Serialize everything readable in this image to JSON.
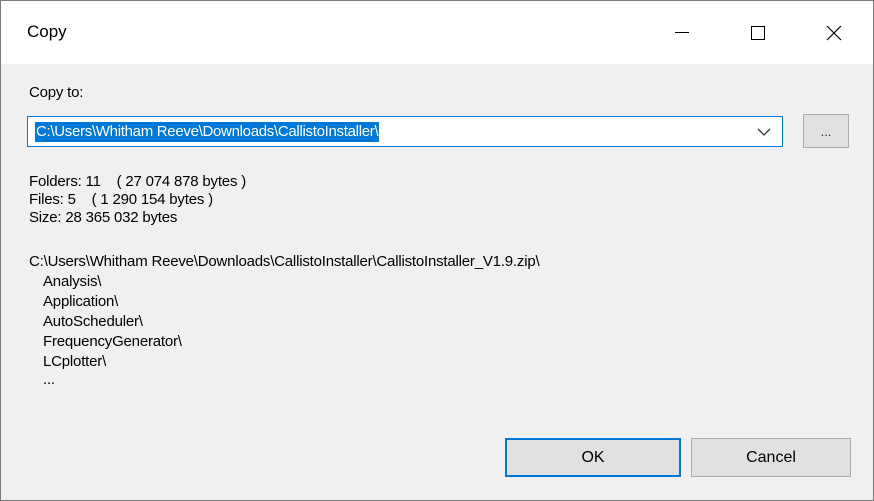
{
  "window": {
    "title": "Copy"
  },
  "copy_to": {
    "label": "Copy to:",
    "path_value": "C:\\Users\\Whitham Reeve\\Downloads\\CallistoInstaller\\",
    "browse_label": "..."
  },
  "stats": {
    "folders": "Folders: 11    ( 27 074 878 bytes )",
    "files": "Files: 5    ( 1 290 154 bytes )",
    "size": "Size: 28 365 032 bytes"
  },
  "items": {
    "source": "C:\\Users\\Whitham Reeve\\Downloads\\CallistoInstaller\\CallistoInstaller_V1.9.zip\\",
    "list": [
      "Analysis\\",
      "Application\\",
      "AutoScheduler\\",
      "FrequencyGenerator\\",
      "LCplotter\\",
      "..."
    ]
  },
  "buttons": {
    "ok": "OK",
    "cancel": "Cancel"
  },
  "icons": {
    "minimize": "minimize-icon",
    "maximize": "maximize-icon",
    "close": "close-icon",
    "dropdown": "chevron-down-icon"
  }
}
